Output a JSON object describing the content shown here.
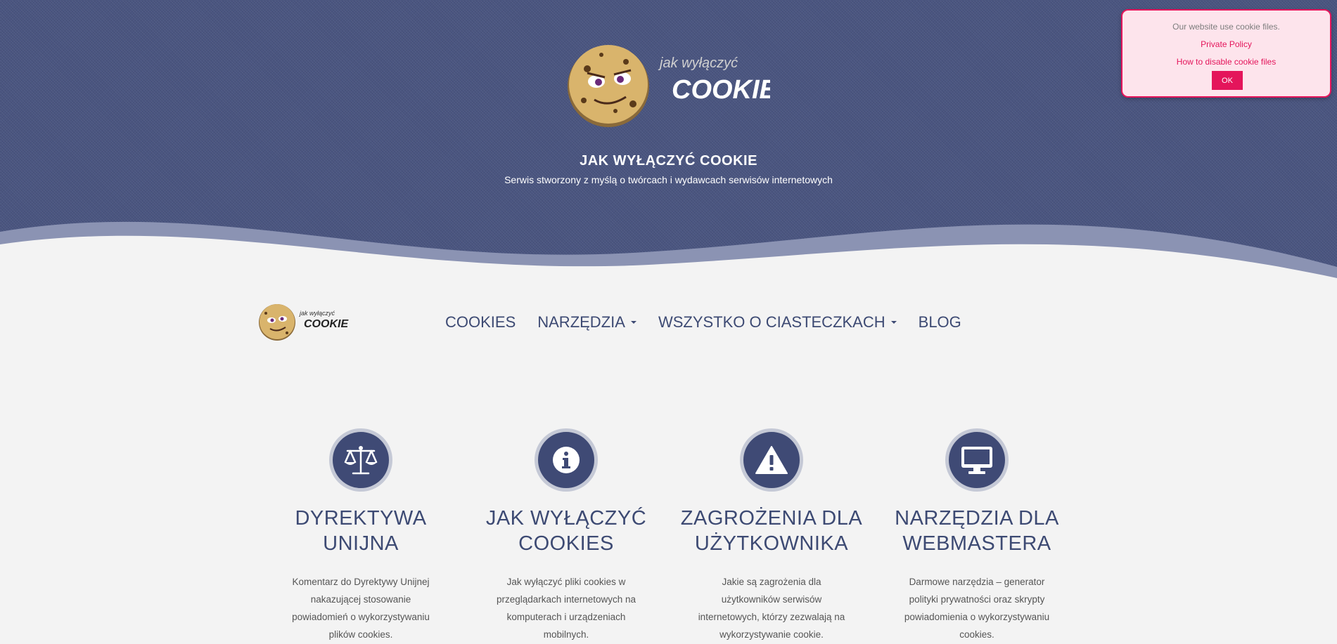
{
  "hero": {
    "logo_small_text": "jak wyłączyć",
    "logo_big_text": "COOKIE?",
    "title": "JAK WYŁĄCZYĆ COOKIE",
    "subtitle": "Serwis stworzony z myślą o twórcach i wydawcach serwisów internetowych"
  },
  "cookie_notice": {
    "text": "Our website use cookie files.",
    "privacy_link": "Private Policy",
    "disable_link": "How to disable cookie files",
    "ok_label": "OK"
  },
  "nav": {
    "logo_small_text": "jak wyłączyć",
    "logo_big_text": "COOKIE?",
    "items": [
      {
        "label": "COOKIES",
        "dropdown": false
      },
      {
        "label": "NARZĘDZIA",
        "dropdown": true
      },
      {
        "label": "WSZYSTKO O CIASTECZKACH",
        "dropdown": true
      },
      {
        "label": "BLOG",
        "dropdown": false
      }
    ]
  },
  "features": [
    {
      "icon": "scales-icon",
      "title_line1": "DYREKTYWA",
      "title_line2": "UNIJNA",
      "description": "Komentarz do Dyrektywy Unijnej nakazującej stosowanie powiadomień o wykorzystywaniu plików cookies."
    },
    {
      "icon": "info-icon",
      "title_line1": "JAK WYŁĄCZYĆ",
      "title_line2": "COOKIES",
      "description": "Jak wyłączyć pliki cookies w przeglądarkach internetowych na komputerach i urządzeniach mobilnych."
    },
    {
      "icon": "warning-icon",
      "title_line1": "ZAGROŻENIA DLA",
      "title_line2": "UŻYTKOWNIKA",
      "description": "Jakie są zagrożenia dla użytkowników serwisów internetowych, którzy zezwalają na wykorzystywanie cookie."
    },
    {
      "icon": "monitor-icon",
      "title_line1": "NARZĘDZIA DLA",
      "title_line2": "WEBMASTERA",
      "description": "Darmowe narzędzia – generator polityki prywatności oraz skrypty powiadomienia o wykorzystywaniu cookies."
    }
  ],
  "colors": {
    "hero_bg": "#4a5580",
    "accent": "#e4155b",
    "text_primary": "#3d4a73",
    "icon_circle": "#3f4a75"
  }
}
